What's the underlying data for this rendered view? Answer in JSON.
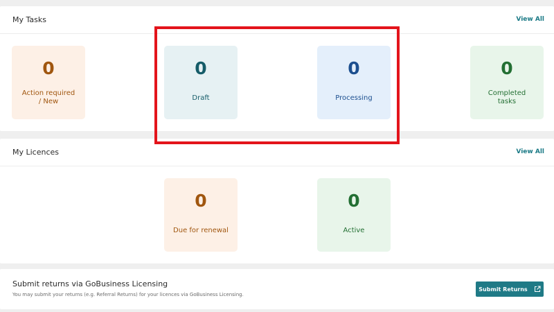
{
  "tasks": {
    "title": "My Tasks",
    "view_all": "View All",
    "tiles": [
      {
        "count": "0",
        "label": "Action required\n/ New"
      },
      {
        "count": "0",
        "label": "Draft"
      },
      {
        "count": "0",
        "label": "Processing"
      },
      {
        "count": "0",
        "label": "Completed\ntasks"
      }
    ]
  },
  "licences": {
    "title": "My Licences",
    "view_all": "View All",
    "tiles": [
      {
        "count": "0",
        "label": "Due for renewal"
      },
      {
        "count": "0",
        "label": "Active"
      }
    ]
  },
  "returns": {
    "title": "Submit returns via GoBusiness Licensing",
    "description": "You may submit your returns (e.g. Referral Returns) for your licences via GoBusiness Licensing.",
    "button_label": "Submit Returns",
    "button_icon": "external-link-icon"
  },
  "colors": {
    "accent": "#1f7a86",
    "highlight": "#e3141b",
    "orange_text": "#a0560f",
    "teal_text": "#155c68",
    "blue_text": "#1c4f8f",
    "green_text": "#236f33"
  }
}
